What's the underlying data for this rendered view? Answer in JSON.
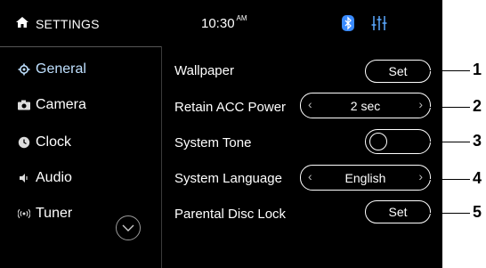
{
  "header": {
    "title": "SETTINGS",
    "time": "10:30",
    "ampm": "AM",
    "icons": [
      "home-icon",
      "bluetooth-icon",
      "equalizer-icon"
    ]
  },
  "sidebar": {
    "items": [
      {
        "label": "General",
        "icon": "gear-icon",
        "active": true
      },
      {
        "label": "Camera",
        "icon": "camera-icon",
        "active": false
      },
      {
        "label": "Clock",
        "icon": "clock-icon",
        "active": false
      },
      {
        "label": "Audio",
        "icon": "speaker-icon",
        "active": false
      },
      {
        "label": "Tuner",
        "icon": "radio-icon",
        "active": false
      }
    ]
  },
  "settings": [
    {
      "label": "Wallpaper",
      "control": "button",
      "value": "Set"
    },
    {
      "label": "Retain ACC Power",
      "control": "selector",
      "value": "2 sec"
    },
    {
      "label": "System Tone",
      "control": "toggle",
      "value": ""
    },
    {
      "label": "System Language",
      "control": "selector",
      "value": "English"
    },
    {
      "label": "Parental Disc Lock",
      "control": "button",
      "value": "Set"
    }
  ],
  "callouts": [
    "1",
    "2",
    "3",
    "4",
    "5"
  ],
  "colors": {
    "background": "#000000",
    "active": "#bfe0ff",
    "bluetooth": "#3a8bff",
    "equalizer": "#5aa8ff"
  }
}
